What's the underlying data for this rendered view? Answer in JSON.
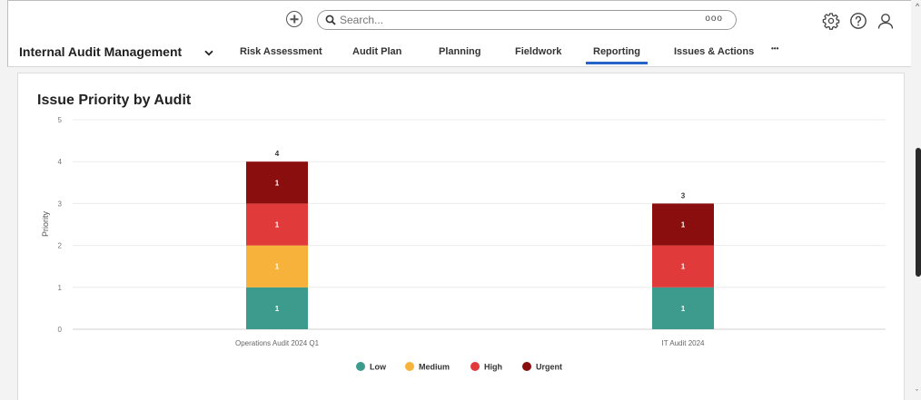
{
  "topbar": {
    "search_placeholder": "Search...",
    "search_more": "ooo"
  },
  "navbar": {
    "app_title": "Internal Audit Management",
    "tabs": [
      {
        "label": "Risk Assessment"
      },
      {
        "label": "Audit Plan"
      },
      {
        "label": "Planning"
      },
      {
        "label": "Fieldwork"
      },
      {
        "label": "Reporting",
        "active": true
      },
      {
        "label": "Issues & Actions"
      },
      {
        "label": "•••"
      }
    ]
  },
  "card": {
    "title": "Issue Priority by Audit"
  },
  "chart_data": {
    "type": "bar",
    "stacked": true,
    "title": "Issue Priority by Audit",
    "xlabel": "",
    "ylabel": "Priority",
    "ylim": [
      0,
      5
    ],
    "yticks": [
      0,
      1,
      2,
      3,
      4,
      5
    ],
    "grid": true,
    "legend": "bottom",
    "categories": [
      "Operations Audit 2024 Q1",
      "IT Audit 2024"
    ],
    "series": [
      {
        "name": "Low",
        "color": "#3d9b8e",
        "values": [
          1,
          1
        ]
      },
      {
        "name": "Medium",
        "color": "#f7b23b",
        "values": [
          1,
          0
        ]
      },
      {
        "name": "High",
        "color": "#e13a3a",
        "values": [
          1,
          1
        ]
      },
      {
        "name": "Urgent",
        "color": "#8b0e0e",
        "values": [
          1,
          1
        ]
      }
    ],
    "totals": [
      4,
      3
    ]
  }
}
